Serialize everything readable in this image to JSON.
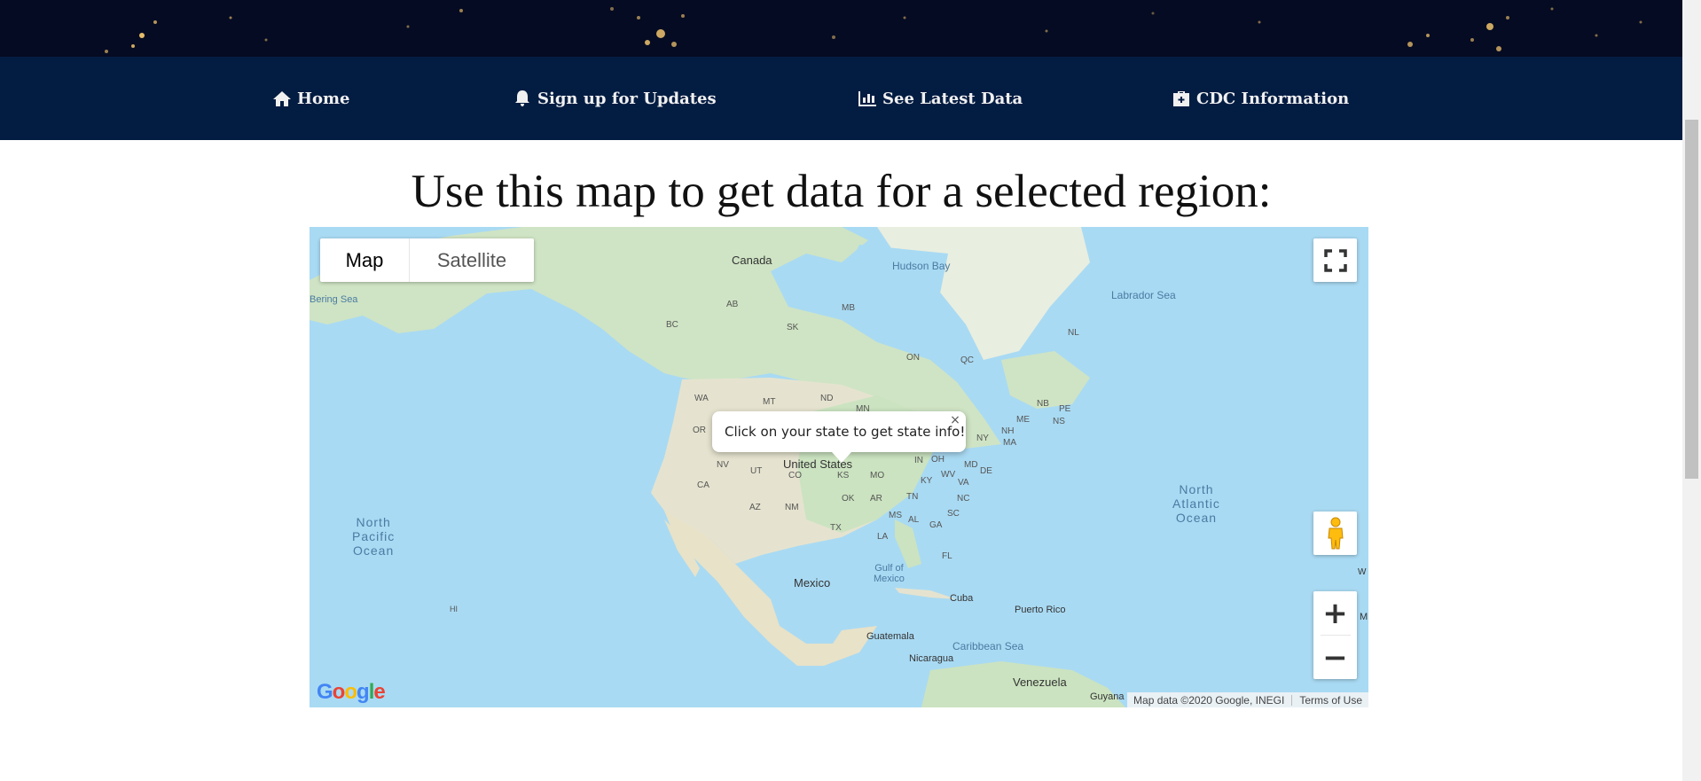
{
  "nav": {
    "items": [
      {
        "label": "Home",
        "icon": "home-icon"
      },
      {
        "label": "Sign up for Updates",
        "icon": "bell-icon"
      },
      {
        "label": "See Latest Data",
        "icon": "chart-icon"
      },
      {
        "label": "CDC Information",
        "icon": "medkit-icon"
      }
    ]
  },
  "page": {
    "heading": "Use this map to get data for a selected region:"
  },
  "map": {
    "type_options": {
      "map": "Map",
      "satellite": "Satellite"
    },
    "selected_type": "Map",
    "info_window": "Click on your state to get state info!",
    "close_symbol": "×",
    "zoom_in": "+",
    "zoom_out": "−",
    "logo": "Google",
    "attribution": "Map data ©2020 Google, INEGI",
    "terms": "Terms of Use",
    "labels": {
      "canada": "Canada",
      "hudson_bay": "Hudson Bay",
      "labrador_sea": "Labrador Sea",
      "bering_sea": "Bering Sea",
      "ab": "AB",
      "bc": "BC",
      "sk": "SK",
      "mb": "MB",
      "on": "ON",
      "qc": "QC",
      "nl": "NL",
      "nb": "NB",
      "pe": "PE",
      "ns": "NS",
      "wa": "WA",
      "mt": "MT",
      "nd": "ND",
      "mn": "MN",
      "or": "OR",
      "nv": "NV",
      "ut": "UT",
      "co": "CO",
      "ks": "KS",
      "ca": "CA",
      "az": "AZ",
      "nm": "NM",
      "ok": "OK",
      "tx": "TX",
      "mo": "MO",
      "ar": "AR",
      "la": "LA",
      "ms": "MS",
      "al": "AL",
      "ga": "GA",
      "fl": "FL",
      "tn": "TN",
      "ky": "KY",
      "in": "IN",
      "oh": "OH",
      "wv": "WV",
      "va": "VA",
      "nc": "NC",
      "sc": "SC",
      "md": "MD",
      "de": "DE",
      "ny": "NY",
      "nh": "NH",
      "ma": "MA",
      "me": "ME",
      "united_states": "United States",
      "north_pacific_1": "North",
      "north_pacific_2": "Pacific",
      "north_pacific_3": "Ocean",
      "north_atlantic_1": "North",
      "north_atlantic_2": "Atlantic",
      "north_atlantic_3": "Ocean",
      "gulf_1": "Gulf of",
      "gulf_2": "Mexico",
      "mexico": "Mexico",
      "cuba": "Cuba",
      "puerto_rico": "Puerto Rico",
      "guatemala": "Guatemala",
      "nicaragua": "Nicaragua",
      "caribbean_sea": "Caribbean Sea",
      "venezuela": "Venezuela",
      "guyana": "Guyana",
      "hi": "HI",
      "edge_w": "W",
      "edge_m": "M"
    }
  }
}
